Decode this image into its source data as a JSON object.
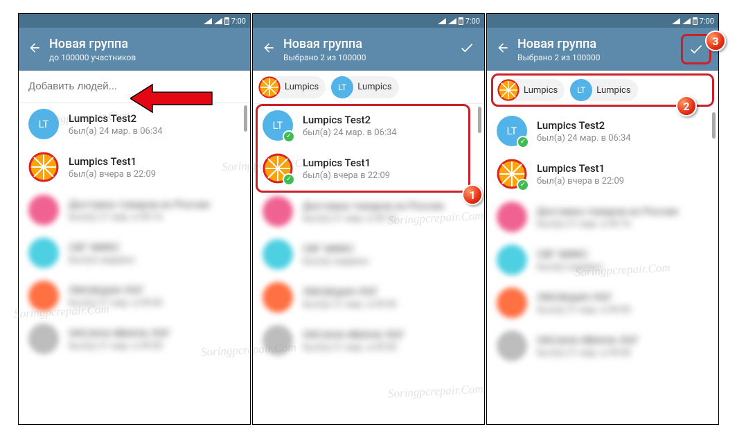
{
  "statusbar": {
    "time": "7:00"
  },
  "screens": [
    {
      "appbar": {
        "title": "Новая группа",
        "subtitle": "до 100000 участников"
      },
      "search_placeholder": "Добавить людей...",
      "contacts": [
        {
          "name": "Lumpics Test2",
          "status": "был(а) 24 мар. в 06:34",
          "avatar": "lt",
          "av_text": "LT",
          "selected": false
        },
        {
          "name": "Lumpics Test1",
          "status": "был(а) вчера в 22:09",
          "avatar": "orange",
          "selected": false
        }
      ]
    },
    {
      "appbar": {
        "title": "Новая группа",
        "subtitle": "Выбрано 2 из 100000"
      },
      "chips": [
        {
          "label": "Lumpics",
          "avatar": "orange"
        },
        {
          "label": "Lumpics",
          "avatar": "lt",
          "av_text": "LT"
        }
      ],
      "contacts": [
        {
          "name": "Lumpics Test2",
          "status": "был(а) 24 мар. в 06:34",
          "avatar": "lt",
          "av_text": "LT",
          "selected": true
        },
        {
          "name": "Lumpics Test1",
          "status": "был(а) вчера в 22:09",
          "avatar": "orange",
          "selected": true
        }
      ]
    },
    {
      "appbar": {
        "title": "Новая группа",
        "subtitle": "Выбрано 2 из 100000"
      },
      "chips": [
        {
          "label": "Lumpics",
          "avatar": "orange"
        },
        {
          "label": "Lumpics",
          "avatar": "lt",
          "av_text": "LT"
        }
      ],
      "contacts": [
        {
          "name": "Lumpics Test2",
          "status": "был(а) 24 мар. в 06:34",
          "avatar": "lt",
          "av_text": "LT",
          "selected": true
        },
        {
          "name": "Lumpics Test1",
          "status": "был(а) вчера в 22:09",
          "avatar": "orange",
          "selected": true
        }
      ]
    }
  ],
  "badges": {
    "b1": "1",
    "b2": "2",
    "b3": "3"
  },
  "watermark": "Soringpcrepair.Com"
}
